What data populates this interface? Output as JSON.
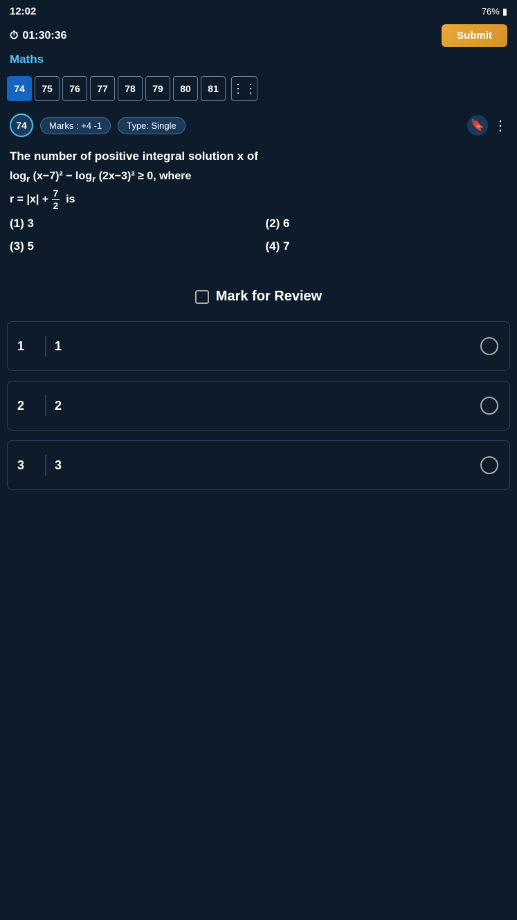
{
  "statusBar": {
    "time": "12:02",
    "battery": "76%",
    "icons": "🔋"
  },
  "timer": {
    "label": "01:30:36",
    "timerIcon": "⏱"
  },
  "submitButton": {
    "label": "Submit"
  },
  "subject": {
    "label": "Maths"
  },
  "questionNumbers": [
    {
      "num": "74",
      "active": true
    },
    {
      "num": "75",
      "active": false
    },
    {
      "num": "76",
      "active": false
    },
    {
      "num": "77",
      "active": false
    },
    {
      "num": "78",
      "active": false
    },
    {
      "num": "79",
      "active": false
    },
    {
      "num": "80",
      "active": false
    },
    {
      "num": "81",
      "active": false
    }
  ],
  "questionMeta": {
    "qNumber": "74",
    "marks": "Marks : +4 -1",
    "type": "Type: Single"
  },
  "questionText": {
    "line1": "The number of positive integral solution x of",
    "line2": "log_r (x−7)² − log_r (2x−3)² ≥ 0, where",
    "line3prefix": "r = |x| + ",
    "fractionNumerator": "7",
    "fractionDenominator": "2",
    "line3suffix": " is"
  },
  "options": {
    "opt1": "(1)  3",
    "opt2": "(2)  6",
    "opt3": "(3)  5",
    "opt4": "(4)  7"
  },
  "markReview": {
    "label": "Mark for Review"
  },
  "answerRows": [
    {
      "leftNum": "1",
      "value": "1"
    },
    {
      "leftNum": "2",
      "value": "2"
    },
    {
      "leftNum": "3",
      "value": "3"
    }
  ]
}
